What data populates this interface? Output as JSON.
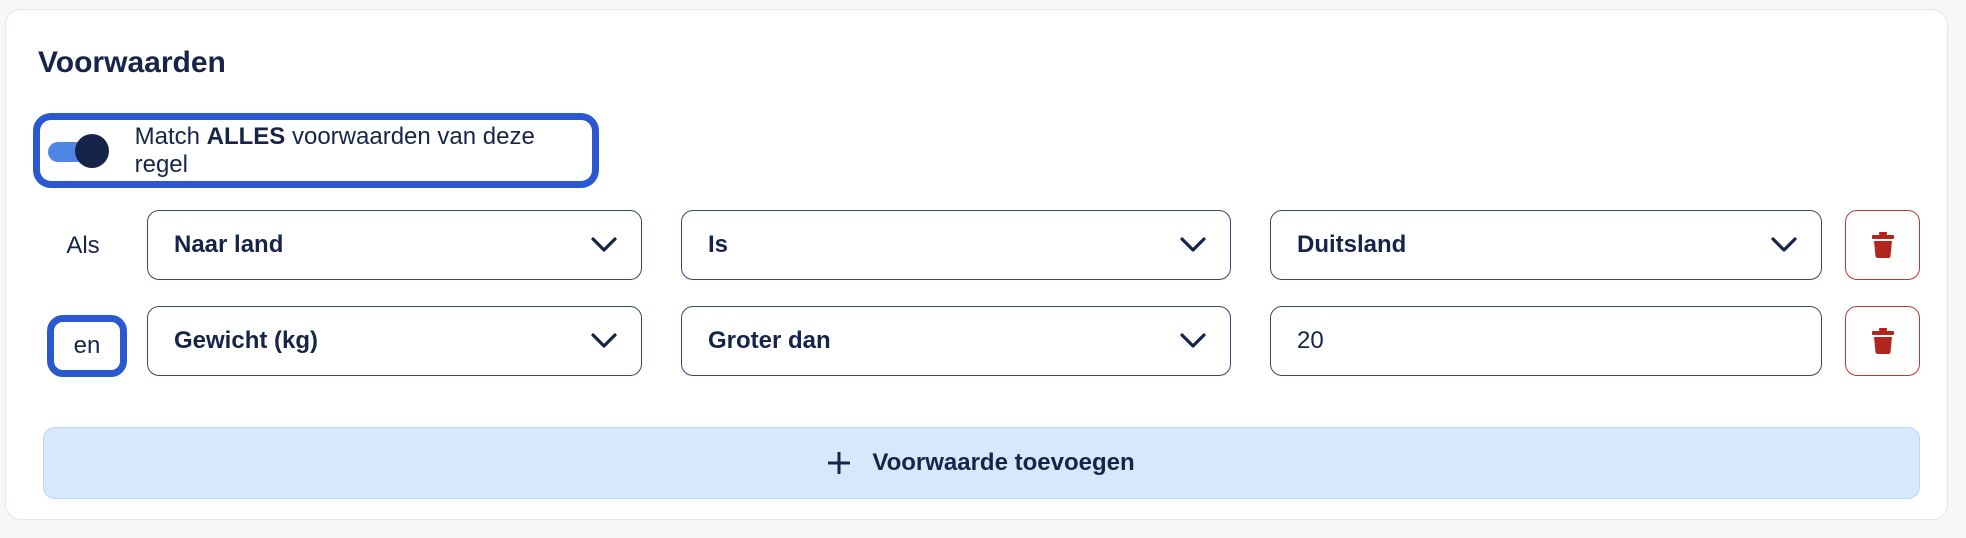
{
  "section": {
    "title": "Voorwaarden"
  },
  "match_toggle": {
    "enabled": true,
    "label_prefix": "Match ",
    "label_bold": "ALLES",
    "label_suffix": " voorwaarden van deze regel"
  },
  "conditions": [
    {
      "conjunction": "Als",
      "field": "Naar land",
      "operator": "Is",
      "value": "Duitsland",
      "value_type": "select"
    },
    {
      "conjunction": "en",
      "field": "Gewicht (kg)",
      "operator": "Groter dan",
      "value": "20",
      "value_type": "input"
    }
  ],
  "add_button": {
    "label": "Voorwaarde toevoegen",
    "icon": "plus-icon"
  },
  "icons": {
    "dropdown": "chevron-down-icon",
    "delete": "trash-icon"
  },
  "colors": {
    "highlight": "#2a58d1",
    "text": "#17244a",
    "toggle_track": "#4f86e3",
    "delete": "#b3261e",
    "add_bg": "#d6e8fb"
  }
}
